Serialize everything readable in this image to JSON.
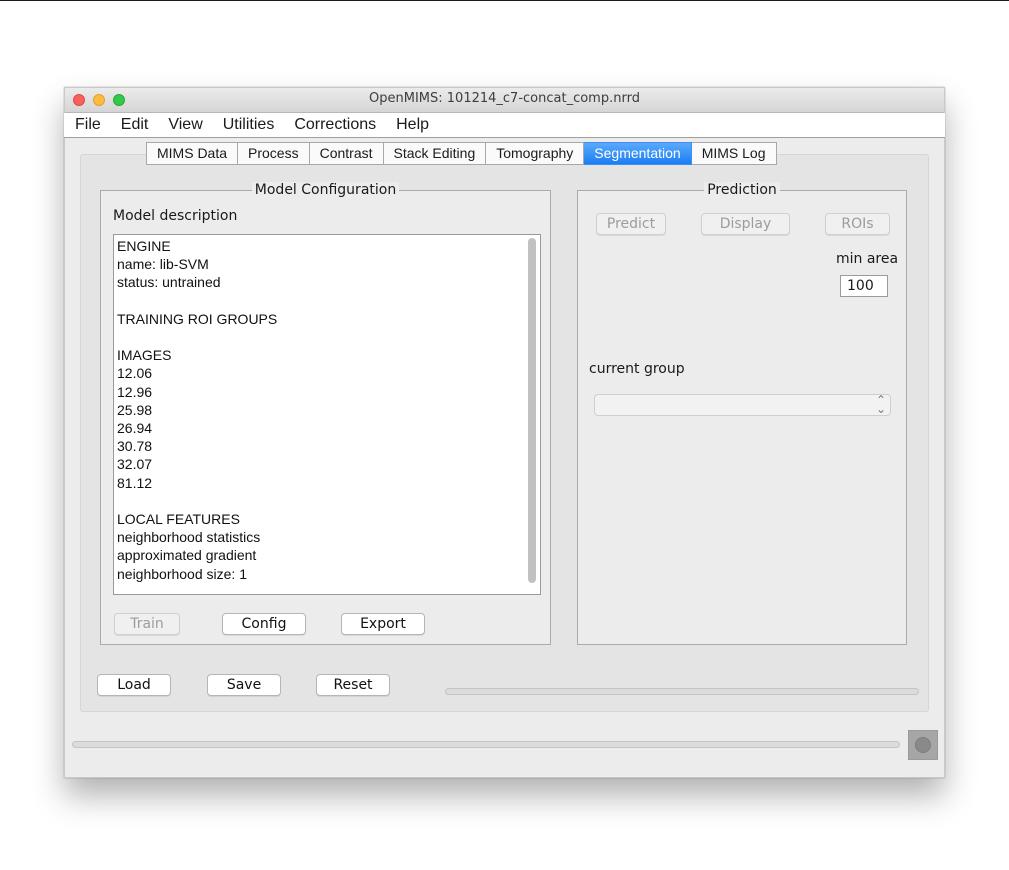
{
  "window": {
    "title": "OpenMIMS: 101214_c7-concat_comp.nrrd"
  },
  "menubar": [
    "File",
    "Edit",
    "View",
    "Utilities",
    "Corrections",
    "Help"
  ],
  "tabs": [
    {
      "label": "MIMS Data",
      "active": false
    },
    {
      "label": "Process",
      "active": false
    },
    {
      "label": "Contrast",
      "active": false
    },
    {
      "label": "Stack Editing",
      "active": false
    },
    {
      "label": "Tomography",
      "active": false
    },
    {
      "label": "Segmentation",
      "active": true
    },
    {
      "label": "MIMS Log",
      "active": false
    }
  ],
  "model_configuration": {
    "legend": "Model Configuration",
    "description_label": "Model description",
    "description_lines": [
      "ENGINE",
      "name: lib-SVM",
      "status: untrained",
      "",
      "TRAINING ROI GROUPS",
      "",
      "IMAGES",
      "12.06",
      "12.96",
      "25.98",
      "26.94",
      "30.78",
      "32.07",
      "81.12",
      "",
      "LOCAL FEATURES",
      "neighborhood statistics",
      "approximated gradient",
      "neighborhood size: 1"
    ],
    "buttons": {
      "train": "Train",
      "config": "Config",
      "export": "Export"
    }
  },
  "prediction": {
    "legend": "Prediction",
    "buttons": {
      "predict": "Predict",
      "display": "Display",
      "rois": "ROIs"
    },
    "min_area_label": "min area",
    "min_area_value": "100",
    "current_group_label": "current group",
    "current_group_value": ""
  },
  "bottom_buttons": {
    "load": "Load",
    "save": "Save",
    "reset": "Reset"
  },
  "colors": {
    "active_tab": "#2a86f5",
    "close": "#fc605c",
    "minimize": "#fdbc40",
    "maximize": "#34c84a"
  }
}
